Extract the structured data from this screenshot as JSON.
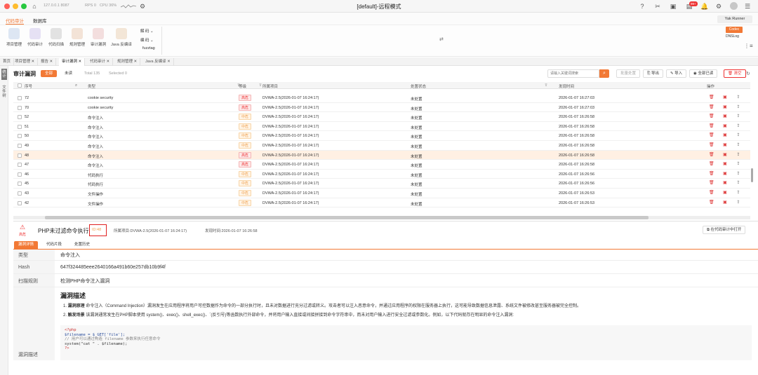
{
  "window": {
    "title": "[default]-远程模式",
    "connection": "127.0.0.1 8087",
    "rps": "RPS 0",
    "cpu": "CPU 36%"
  },
  "menu": {
    "items": [
      "代码审计",
      "数据库"
    ]
  },
  "right": {
    "yak_runner": "Yak Runner",
    "codec": "Codec",
    "dnslog": "DNSLog",
    "badge": "99+"
  },
  "toolbar": {
    "tools": [
      "项目管理",
      "代码审计",
      "代码扫描",
      "规则管理",
      "审计漏洞",
      "Java 反编译"
    ],
    "dropdowns": [
      "解 码",
      "编 码",
      "fuzztag"
    ]
  },
  "tabs": [
    "首页",
    "项目管理",
    "报告",
    "审计漏洞",
    "代码审计",
    "规则管理",
    "Java 反编译"
  ],
  "side": {
    "top": "统计",
    "bottom": "文件树"
  },
  "header": {
    "title": "审计漏洞",
    "filter_all": "全部",
    "filter_unread": "未读",
    "total": "Total 135",
    "selected": "Selected 0",
    "search_placeholder": "请输入关键词搜索",
    "batch": "批量处置",
    "export": "导出",
    "import": "导入",
    "read_all": "全部已读",
    "clear": "清空"
  },
  "columns": [
    "序号",
    "类型",
    "等级",
    "所属项目",
    "处置状态",
    "发现时间",
    "操作"
  ],
  "rows": [
    {
      "id": "72",
      "type": "cookie security",
      "level": "高危",
      "project": "DVWA-2.5(2026-01-07 16:24:17)",
      "status": "未处置",
      "time": "2026-01-07 16:27:03"
    },
    {
      "id": "70",
      "type": "cookie security",
      "level": "高危",
      "project": "DVWA-2.5(2026-01-07 16:24:17)",
      "status": "未处置",
      "time": "2026-01-07 16:27:03"
    },
    {
      "id": "52",
      "type": "命令注入",
      "level": "中危",
      "project": "DVWA-2.5(2026-01-07 16:24:17)",
      "status": "未处置",
      "time": "2026-01-07 16:26:58"
    },
    {
      "id": "51",
      "type": "命令注入",
      "level": "中危",
      "project": "DVWA-2.5(2026-01-07 16:24:17)",
      "status": "未处置",
      "time": "2026-01-07 16:26:58"
    },
    {
      "id": "50",
      "type": "命令注入",
      "level": "中危",
      "project": "DVWA-2.5(2026-01-07 16:24:17)",
      "status": "未处置",
      "time": "2026-01-07 16:26:58"
    },
    {
      "id": "49",
      "type": "命令注入",
      "level": "中危",
      "project": "DVWA-2.5(2026-01-07 16:24:17)",
      "status": "未处置",
      "time": "2026-01-07 16:26:58"
    },
    {
      "id": "48",
      "type": "命令注入",
      "level": "高危",
      "project": "DVWA-2.5(2026-01-07 16:24:17)",
      "status": "未处置",
      "time": "2026-01-07 16:26:58"
    },
    {
      "id": "47",
      "type": "命令注入",
      "level": "高危",
      "project": "DVWA-2.5(2026-01-07 16:24:17)",
      "status": "未处置",
      "time": "2026-01-07 16:26:58"
    },
    {
      "id": "46",
      "type": "代码执行",
      "level": "中危",
      "project": "DVWA-2.5(2026-01-07 16:24:17)",
      "status": "未处置",
      "time": "2026-01-07 16:26:56"
    },
    {
      "id": "45",
      "type": "代码执行",
      "level": "中危",
      "project": "DVWA-2.5(2026-01-07 16:24:17)",
      "status": "未处置",
      "time": "2026-01-07 16:26:56"
    },
    {
      "id": "43",
      "type": "文件操作",
      "level": "中危",
      "project": "DVWA-2.5(2026-01-07 16:24:17)",
      "status": "未处置",
      "time": "2026-01-07 16:26:53"
    },
    {
      "id": "42",
      "type": "文件操作",
      "level": "中危",
      "project": "DVWA-2.5(2026-01-07 16:24:17)",
      "status": "未处置",
      "time": "2026-01-07 16:26:53"
    }
  ],
  "selected_row_id": "48",
  "detail": {
    "severity": "高危",
    "title": "PHP未过滤命令执行",
    "id": "ID:48",
    "project": "所属项目:DVWA-2.5(2026-01-07 16:24:17)",
    "time": "发现时间:2026-01-07 16:26:58",
    "open_btn": "在代码审计中打开",
    "tabs": [
      "漏洞详情",
      "代码片段",
      "处置历史"
    ],
    "type_key": "类型",
    "type_val": "命令注入",
    "hash_key": "Hash",
    "hash_val": "647f324485eee2640166a491b60e257db10b9f4f",
    "rule_key": "扫描规则",
    "rule_val": "检测PHP命令注入漏洞",
    "desc_key": "漏洞描述",
    "desc_title": "漏洞描述",
    "p1_label": "漏洞原理",
    "p1": "命令注入（Command Injection）漏洞发生在应用程序将用户可控数据作为命令的一部分执行时，且未对数据进行充分过滤或转义。攻击者可以注入恶意命令，并通过应用程序的权限在服务器上执行，这可能导致数据信息泄露、系统文件被修改甚至服务器被完全控制。",
    "p2_label": "触发场景",
    "p2": "该漏洞通常发生在PHP脚本使用 system()、exec()、shell_exec()、`(反引号)等函数执行外部命令，并将用户输入直接或间接拼接到命令字符串中，而未对用户输入进行安全过滤或参数化。例如，以下代码就存在明显的命令注入漏洞:",
    "code": [
      "<?php",
      "$filename = $_GET['file'];",
      "// 用户可以通过构造 filename 参数来执行任意命令",
      "system(\"cat \" . $filename);",
      "?>"
    ]
  }
}
